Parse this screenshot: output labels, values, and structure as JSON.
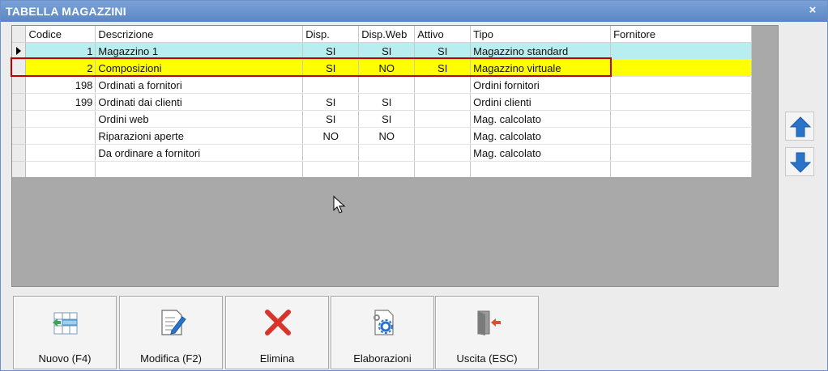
{
  "window": {
    "title": "TABELLA MAGAZZINI",
    "close_glyph": "×"
  },
  "grid": {
    "columns": [
      "Codice",
      "Descrizione",
      "Disp.",
      "Disp.Web",
      "Attivo",
      "Tipo",
      "Fornitore"
    ],
    "rows": [
      [
        "1",
        "Magazzino 1",
        "SI",
        "SI",
        "SI",
        "Magazzino standard",
        ""
      ],
      [
        "2",
        "Composizioni",
        "SI",
        "NO",
        "SI",
        "Magazzino virtuale",
        ""
      ],
      [
        "198",
        "Ordinati a fornitori",
        "",
        "",
        "",
        "Ordini fornitori",
        ""
      ],
      [
        "199",
        "Ordinati dai clienti",
        "SI",
        "SI",
        "",
        "Ordini clienti",
        ""
      ],
      [
        "",
        "Ordini web",
        "SI",
        "SI",
        "",
        "Mag. calcolato",
        ""
      ],
      [
        "",
        "Riparazioni aperte",
        "NO",
        "NO",
        "",
        "Mag. calcolato",
        ""
      ],
      [
        "",
        "Da ordinare a fornitori",
        "",
        "",
        "",
        "Mag. calcolato",
        ""
      ],
      [
        "",
        "",
        "",
        "",
        "",
        "",
        ""
      ]
    ]
  },
  "buttons": {
    "nuovo": "Nuovo (F4)",
    "modifica": "Modifica (F2)",
    "elimina": "Elimina",
    "elaborazioni": "Elaborazioni",
    "uscita": "Uscita (ESC)"
  },
  "icons": {
    "move_up": "arrow-up-icon",
    "move_down": "arrow-down-icon"
  },
  "colors": {
    "current_row": "#b8eef0",
    "highlight_row": "#ffff00",
    "highlight_frame": "#c00000",
    "accent_blue": "#2a73c8",
    "delete_red": "#d8342a"
  }
}
